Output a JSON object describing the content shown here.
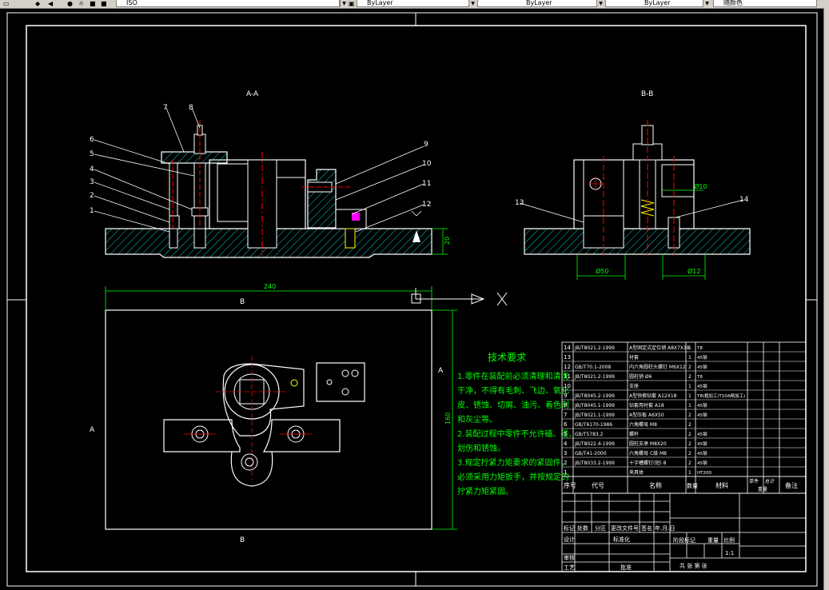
{
  "toolbar": {
    "combo1": "ISO",
    "combo2": "ByLayer",
    "combo3": "ByLayer",
    "combo4": "ByLayer",
    "combo5": "随颜色"
  },
  "drawing": {
    "section_aa": "A-A",
    "section_bb": "B-B",
    "dim_240": "240",
    "dim_160": "160",
    "dim_20": "20",
    "dim_50": "Ø50",
    "dim_12": "Ø12",
    "dim_10": "Ø10",
    "label_a": "A",
    "label_b": "B",
    "balloons": [
      "1",
      "2",
      "3",
      "4",
      "5",
      "6",
      "7",
      "8",
      "9",
      "10",
      "11",
      "12",
      "13",
      "14"
    ]
  },
  "tech_req": {
    "title": "技术要求",
    "lines": [
      "1.零件在装配前必须清理和清洗",
      "干净，不得有毛刺、飞边、氧化",
      "皮、锈蚀、切屑、油污、着色剂",
      "和灰尘等。",
      "2.装配过程中零件不允许磕、碰、",
      "划伤和锈蚀。",
      "3.规定拧紧力矩要求的紧固件，",
      "必须采用力矩扳手，并按规定的",
      "拧紧力矩紧固。"
    ]
  },
  "bom": {
    "rows": [
      {
        "no": "14",
        "code": "JB/T8021.2-1999",
        "name": "A型固定式定位销 A8X7X18",
        "qty": "1",
        "mat": "T8",
        "note": ""
      },
      {
        "no": "13",
        "code": "",
        "name": "衬套",
        "qty": "1",
        "mat": "45钢",
        "note": ""
      },
      {
        "no": "12",
        "code": "GB/T70.1-2008",
        "name": "内六角圆柱头螺钉 M6X12",
        "qty": "2",
        "mat": "45钢",
        "note": ""
      },
      {
        "no": "11",
        "code": "JB/T8021.2-1999",
        "name": "圆柱销 Ø6",
        "qty": "2",
        "mat": "T8",
        "note": ""
      },
      {
        "no": "10",
        "code": "",
        "name": "支座",
        "qty": "1",
        "mat": "45钢",
        "note": ""
      },
      {
        "no": "9",
        "code": "JB/T8045.2-1999",
        "name": "A型快换钻套 A12X18",
        "qty": "1",
        "mat": "T8(粗加工/T10A精加工)",
        "note": ""
      },
      {
        "no": "8",
        "code": "JB/T8045.1-1999",
        "name": "钻套用衬套 A18",
        "qty": "1",
        "mat": "45钢",
        "note": ""
      },
      {
        "no": "7",
        "code": "JB/T8021.1-1999",
        "name": "A型压板 A6X50",
        "qty": "2",
        "mat": "45钢",
        "note": ""
      },
      {
        "no": "6",
        "code": "GB/T6170-1986",
        "name": "六角螺母 M8",
        "qty": "2",
        "mat": "",
        "note": ""
      },
      {
        "no": "5",
        "code": "GB/T5783.2",
        "name": "螺杆",
        "qty": "2",
        "mat": "45钢",
        "note": ""
      },
      {
        "no": "4",
        "code": "JB/T8022.4-1999",
        "name": "圆柱支承 M8X20",
        "qty": "2",
        "mat": "45钢",
        "note": ""
      },
      {
        "no": "3",
        "code": "GB/T41-2000",
        "name": "六角螺母 C级 M8",
        "qty": "2",
        "mat": "45钢",
        "note": ""
      },
      {
        "no": "2",
        "code": "JB/T8033.2-1999",
        "name": "十字槽螺钉(短) 8",
        "qty": "2",
        "mat": "45钢",
        "note": ""
      },
      {
        "no": "1",
        "code": "",
        "name": "夹具体",
        "qty": "1",
        "mat": "HT200",
        "note": ""
      }
    ],
    "header": {
      "no": "序号",
      "code": "代号",
      "name": "名称",
      "qty": "数量",
      "mat": "材料",
      "weight1": "单件",
      "weight2": "总计",
      "weight3": "重量",
      "note": "备注"
    }
  },
  "titleblock": {
    "t1": "标记",
    "t2": "处数",
    "t3": "分区",
    "t4": "更改文件号",
    "t5": "签名",
    "t6": "年.月.日",
    "design": "设计",
    "std": "标准化",
    "check": "审核",
    "process": "工艺",
    "approve": "批准",
    "stage": "阶段标记",
    "weight": "重量",
    "scale": "比例",
    "scale_val": "1:1",
    "sheets": "共 张 第 张"
  },
  "colors": {
    "bg": "#000000",
    "line": "#ffffff",
    "green": "#00ff00",
    "cyan": "#00ffff",
    "red": "#ff0000",
    "yellow": "#ffff00",
    "magenta": "#ff00ff"
  }
}
